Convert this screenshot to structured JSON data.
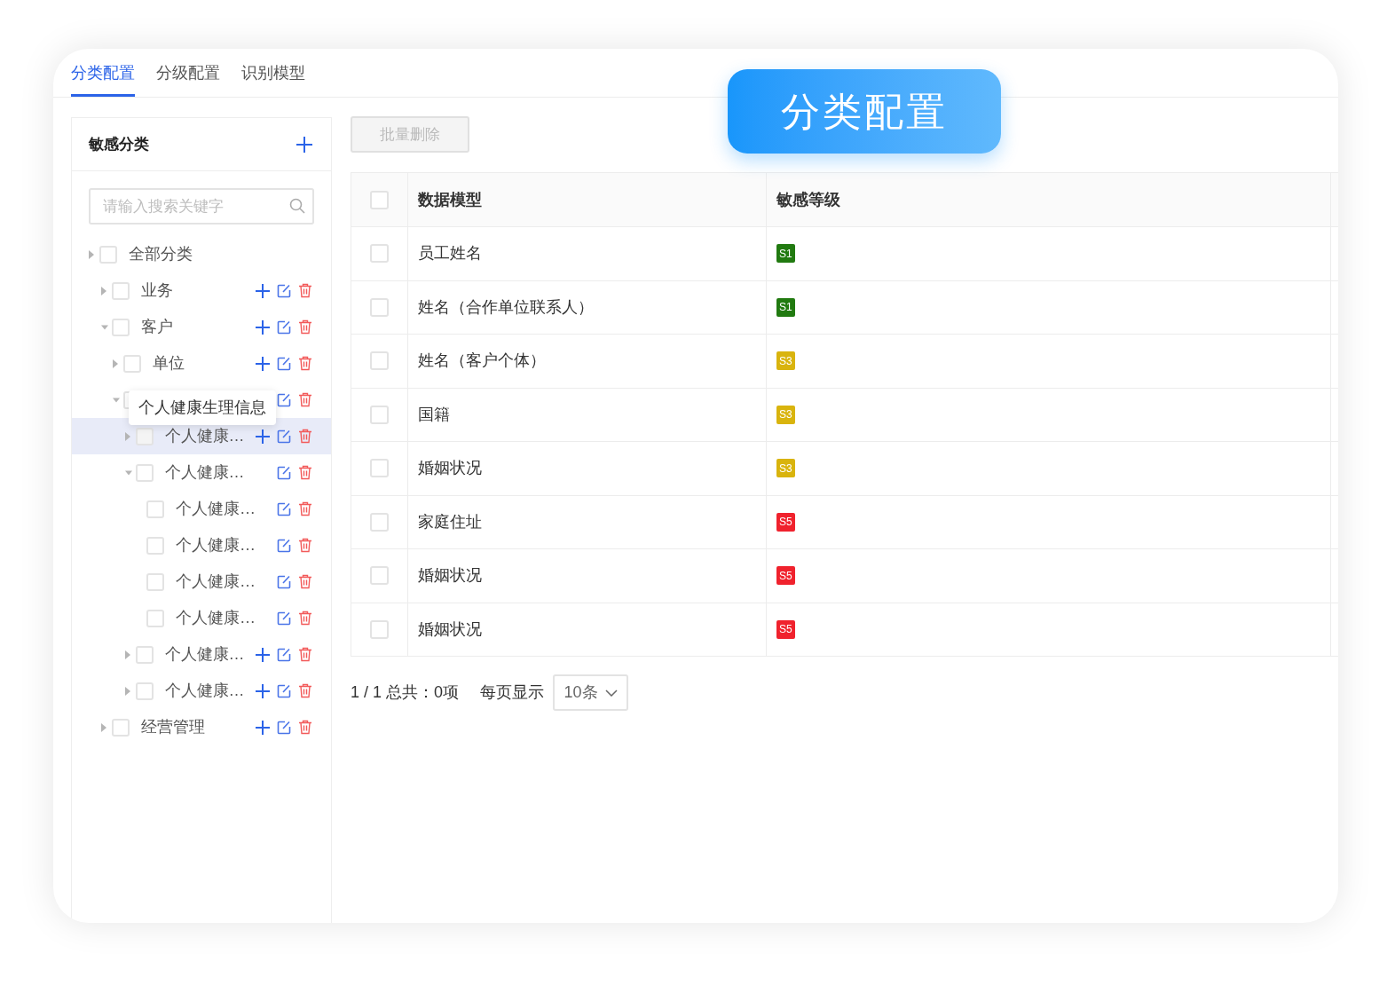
{
  "tabs": [
    {
      "label": "分类配置",
      "selected": true
    },
    {
      "label": "分级配置",
      "selected": false
    },
    {
      "label": "识别模型",
      "selected": false
    }
  ],
  "banner": {
    "text": "分类配置"
  },
  "sidebar": {
    "title": "敏感分类",
    "search": {
      "placeholder": "请输入搜索关键字"
    },
    "tree": [
      {
        "label": "全部分类",
        "kind": "branch",
        "expanded": false,
        "checked": false,
        "addable": false,
        "editable": false,
        "hovered": false,
        "children": [
          {
            "label": "业务",
            "kind": "branch",
            "expanded": false,
            "checked": false,
            "addable": true,
            "hovered": false
          },
          {
            "label": "客户",
            "kind": "branch",
            "expanded": true,
            "checked": false,
            "addable": true,
            "hovered": false,
            "children": [
              {
                "label": "单位",
                "kind": "branch",
                "expanded": false,
                "checked": false,
                "addable": true,
                "hovered": false
              },
              {
                "kind": "branch",
                "expanded": true,
                "checked": false,
                "addable": false,
                "hovered": false,
                "children": [
                  {
                    "label": "个人健康…",
                    "kind": "branch",
                    "expanded": false,
                    "checked": false,
                    "addable": true,
                    "hovered": true
                  },
                  {
                    "label": "个人健康…",
                    "kind": "branch",
                    "expanded": true,
                    "checked": false,
                    "addable": false,
                    "hovered": false,
                    "children": [
                      {
                        "label": "个人健康…",
                        "kind": "leaf",
                        "checked": false,
                        "addable": false,
                        "hovered": false
                      },
                      {
                        "label": "个人健康…",
                        "kind": "leaf",
                        "checked": false,
                        "addable": false,
                        "hovered": false
                      },
                      {
                        "label": "个人健康…",
                        "kind": "leaf",
                        "checked": false,
                        "addable": false,
                        "hovered": false
                      },
                      {
                        "label": "个人健康…",
                        "kind": "leaf",
                        "checked": false,
                        "addable": false,
                        "hovered": false
                      }
                    ]
                  },
                  {
                    "label": "个人健康…",
                    "kind": "branch",
                    "expanded": false,
                    "checked": false,
                    "addable": true,
                    "hovered": false
                  },
                  {
                    "label": "个人健康…",
                    "kind": "branch",
                    "expanded": false,
                    "checked": false,
                    "addable": true,
                    "hovered": false
                  }
                ]
              }
            ]
          },
          {
            "label": "经营管理",
            "kind": "branch",
            "expanded": false,
            "checked": false,
            "addable": true,
            "hovered": false
          }
        ]
      }
    ],
    "tooltip": "个人健康生理信息"
  },
  "toolbar": {
    "batch_delete": {
      "label": "批量删除",
      "disabled": true
    }
  },
  "table": {
    "select_all_checked": false,
    "columns": [
      "数据模型",
      "敏感等级"
    ],
    "rows": [
      {
        "name": "员工姓名",
        "level": "S1",
        "color": "#217a10",
        "checked": false
      },
      {
        "name": "姓名（合作单位联系人）",
        "level": "S1",
        "color": "#217a10",
        "checked": false
      },
      {
        "name": "姓名（客户个体）",
        "level": "S3",
        "color": "#d9b40e",
        "checked": false
      },
      {
        "name": "国籍",
        "level": "S3",
        "color": "#d9b40e",
        "checked": false
      },
      {
        "name": "婚姻状况",
        "level": "S3",
        "color": "#d9b40e",
        "checked": false
      },
      {
        "name": "家庭住址",
        "level": "S5",
        "color": "#f0222d",
        "checked": false
      },
      {
        "name": "婚姻状况",
        "level": "S5",
        "color": "#f0222d",
        "checked": false
      },
      {
        "name": "婚姻状况",
        "level": "S5",
        "color": "#f0222d",
        "checked": false
      }
    ]
  },
  "pagination": {
    "summary": "1 / 1 总共：0项",
    "page_size_label": "每页显示",
    "page_size": "10条"
  }
}
